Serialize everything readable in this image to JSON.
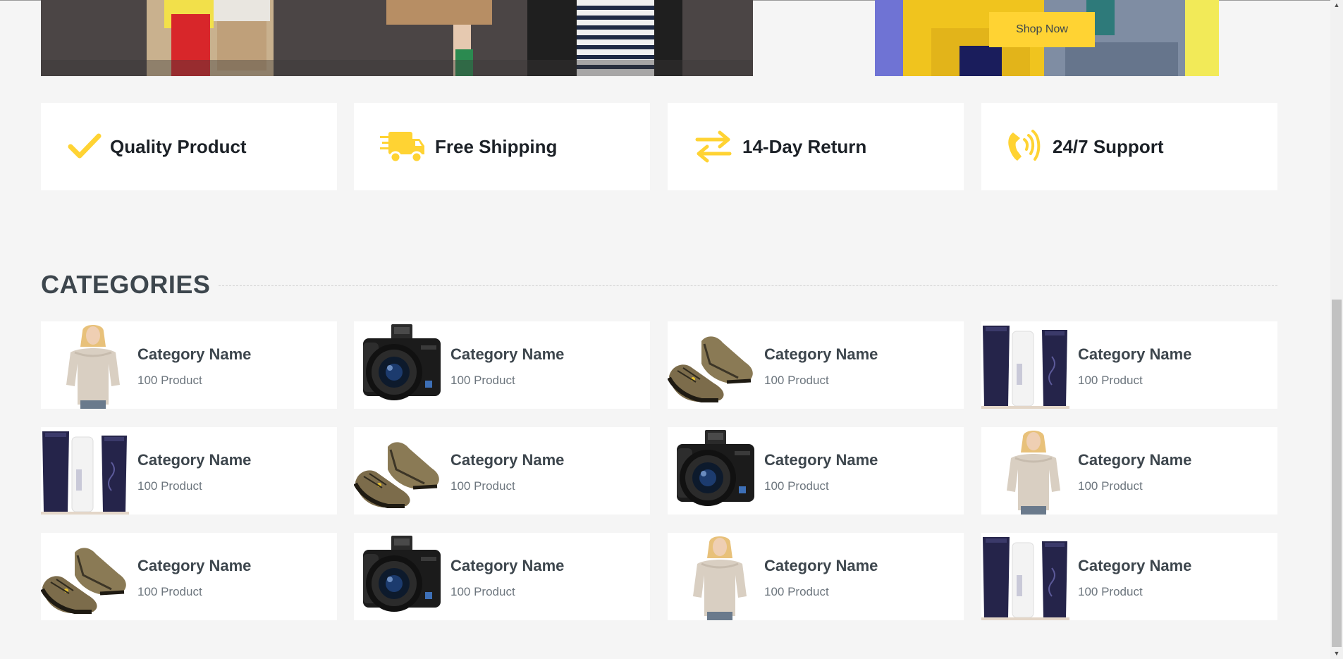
{
  "hero": {
    "shop_now_label": "Shop Now"
  },
  "features": [
    {
      "icon": "check-icon",
      "label": "Quality Product"
    },
    {
      "icon": "shipping-truck-icon",
      "label": "Free Shipping"
    },
    {
      "icon": "exchange-arrows-icon",
      "label": "14-Day Return"
    },
    {
      "icon": "phone-volume-icon",
      "label": "24/7 Support"
    }
  ],
  "categories": {
    "title": "CATEGORIES",
    "items": [
      {
        "image": "fashion-woman",
        "name": "Category Name",
        "count": "100 Product"
      },
      {
        "image": "camera",
        "name": "Category Name",
        "count": "100 Product"
      },
      {
        "image": "shoes",
        "name": "Category Name",
        "count": "100 Product"
      },
      {
        "image": "cosmetics",
        "name": "Category Name",
        "count": "100 Product"
      },
      {
        "image": "cosmetics",
        "name": "Category Name",
        "count": "100 Product"
      },
      {
        "image": "shoes",
        "name": "Category Name",
        "count": "100 Product"
      },
      {
        "image": "camera",
        "name": "Category Name",
        "count": "100 Product"
      },
      {
        "image": "fashion-woman",
        "name": "Category Name",
        "count": "100 Product"
      },
      {
        "image": "shoes",
        "name": "Category Name",
        "count": "100 Product"
      },
      {
        "image": "camera",
        "name": "Category Name",
        "count": "100 Product"
      },
      {
        "image": "fashion-woman",
        "name": "Category Name",
        "count": "100 Product"
      },
      {
        "image": "cosmetics",
        "name": "Category Name",
        "count": "100 Product"
      }
    ]
  },
  "colors": {
    "accent": "#ffd333",
    "page_bg": "#f5f5f5",
    "card_bg": "#ffffff",
    "heading": "#3d464d",
    "muted": "#6c757d"
  }
}
